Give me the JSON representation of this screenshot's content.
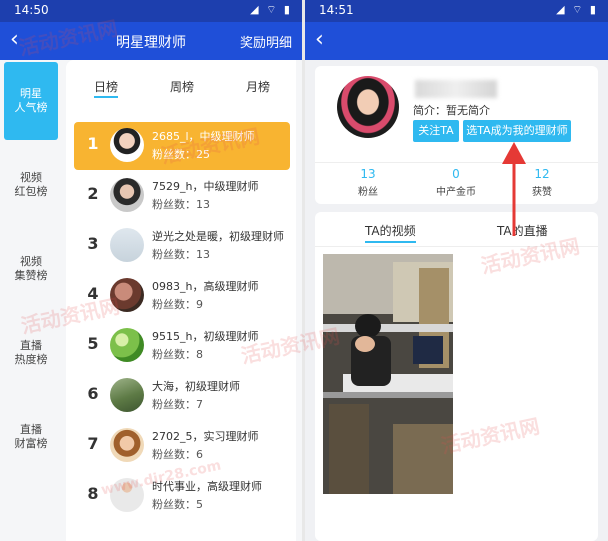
{
  "left": {
    "status_time": "14:50",
    "status_icons": "◢ ⌔ ▮",
    "nav": {
      "back": "‹",
      "title": "明星理财师",
      "action": "奖励明细"
    },
    "sidebar": [
      {
        "label": "明星\n人气榜",
        "active": true
      },
      {
        "label": "视频\n红包榜",
        "active": false
      },
      {
        "label": "视频\n集赞榜",
        "active": false
      },
      {
        "label": "直播\n热度榜",
        "active": false
      },
      {
        "label": "直播\n财富榜",
        "active": false
      }
    ],
    "tabs": [
      {
        "label": "日榜",
        "active": true
      },
      {
        "label": "周榜",
        "active": false
      },
      {
        "label": "月榜",
        "active": false
      }
    ],
    "ranks": [
      {
        "rank": "1",
        "name": "2685_l，中级理财师",
        "fans": "粉丝数：25"
      },
      {
        "rank": "2",
        "name": "7529_h，中级理财师",
        "fans": "粉丝数：13"
      },
      {
        "rank": "3",
        "name": "逆光之处是暖，初级理财师",
        "fans": "粉丝数：13"
      },
      {
        "rank": "4",
        "name": "0983_h，高级理财师",
        "fans": "粉丝数：9"
      },
      {
        "rank": "5",
        "name": "9515_h，初级理财师",
        "fans": "粉丝数：8"
      },
      {
        "rank": "6",
        "name": "大海，初级理财师",
        "fans": "粉丝数：7"
      },
      {
        "rank": "7",
        "name": "2702_5，实习理财师",
        "fans": "粉丝数：6"
      },
      {
        "rank": "8",
        "name": "时代事业，高级理财师",
        "fans": "粉丝数：5"
      }
    ]
  },
  "right": {
    "status_time": "14:51",
    "status_icons": "◢ ⌔ ▮",
    "nav": {
      "back": "‹"
    },
    "intro": "简介：暂无简介",
    "follow_button": "关注TA",
    "choose_button": "选TA成为我的理财师",
    "stats": [
      {
        "value": "13",
        "label": "粉丝"
      },
      {
        "value": "0",
        "label": "中产金币"
      },
      {
        "value": "12",
        "label": "获赞"
      }
    ],
    "content_tabs": [
      {
        "label": "TA的视频",
        "active": true
      },
      {
        "label": "TA的直播",
        "active": false
      }
    ]
  },
  "watermark": "活动资讯网",
  "watermark_url": "www.dir28.com",
  "colors": {
    "nav_blue": "#1f4fd8",
    "accent": "#2fb9f0",
    "gold": "#f8b431",
    "arrow_red": "#e53935"
  }
}
